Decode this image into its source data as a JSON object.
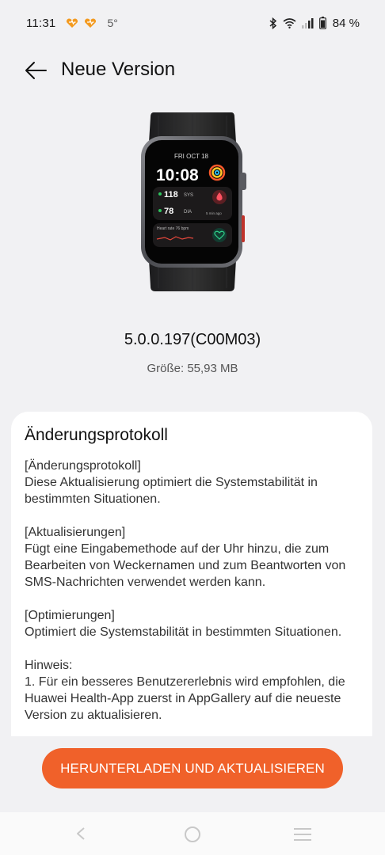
{
  "status_bar": {
    "time": "11:31",
    "temperature": "5°",
    "battery": "84 %",
    "icons": [
      "app-notification-icon",
      "app-notification-icon",
      "bluetooth-icon",
      "wifi-icon",
      "signal-icon",
      "battery-icon"
    ]
  },
  "header": {
    "title": "Neue Version",
    "back_icon": "arrow-left-icon"
  },
  "device": {
    "image": "smartwatch-image",
    "screen": {
      "date": "FRI OCT 18",
      "time": "10:08",
      "sys_value": "118",
      "sys_unit": "SYS",
      "dia_value": "78",
      "dia_unit": "DIA",
      "ago": "5 min ago",
      "heart_rate": "Heart rate 76 bpm"
    }
  },
  "version": "5.0.0.197(C00M03)",
  "size": "Größe: 55,93 MB",
  "changelog": {
    "title": "Änderungsprotokoll",
    "sections": [
      "[Änderungsprotokoll]\nDiese Aktualisierung optimiert die Systemstabilität in bestimmten Situationen.",
      "[Aktualisierungen]\nFügt eine Eingabemethode auf der Uhr hinzu, die zum Bearbeiten von Weckernamen und zum Beantworten von SMS-Nachrichten verwendet werden kann.",
      "[Optimierungen]\nOptimiert die Systemstabilität in bestimmten Situationen.",
      "Hinweis:\n1. Für ein besseres Benutzererlebnis wird empfohlen, die Huawei Health-App zuerst in AppGallery auf die neueste Version zu aktualisieren."
    ]
  },
  "download_button": "HERUNTERLADEN UND AKTUALISIEREN",
  "nav_bar": {
    "icons": [
      "nav-back-icon",
      "nav-home-icon",
      "nav-menu-icon"
    ]
  },
  "colors": {
    "accent": "#f0612a",
    "background": "#f1f1f3",
    "card": "#ffffff"
  }
}
